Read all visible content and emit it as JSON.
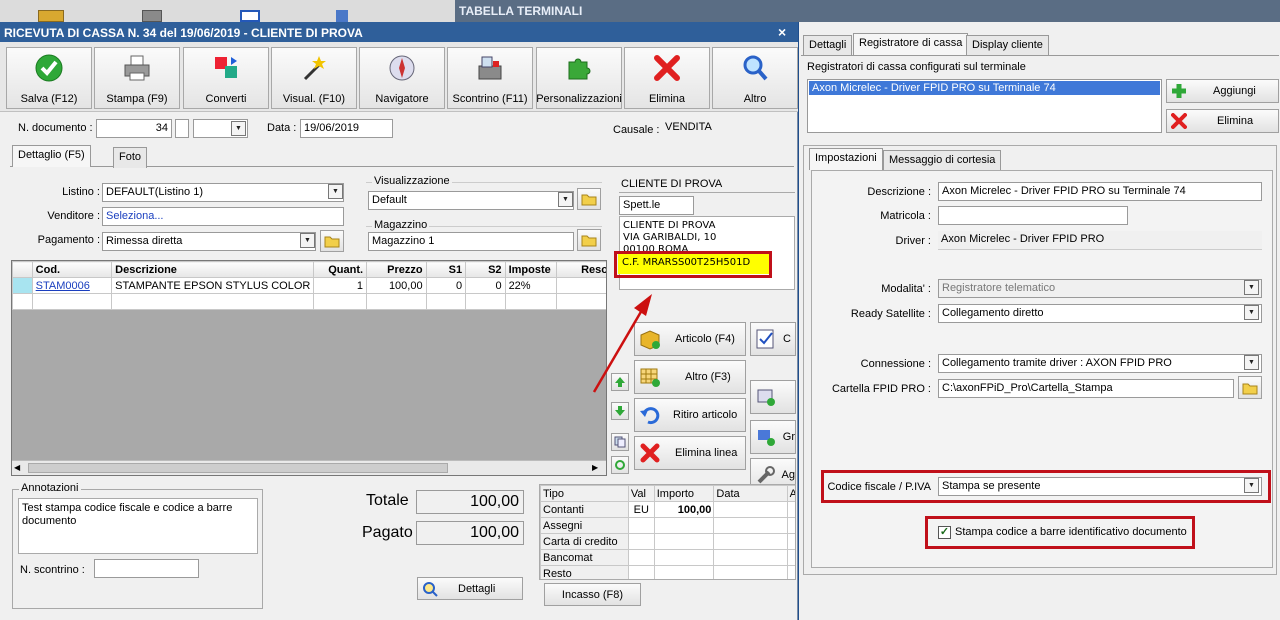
{
  "colors": {
    "desktop": "#1f4e8c",
    "titlebar": "#2f5f9a",
    "highlight_border": "#c0101a",
    "cf_background": "#ffff00",
    "link": "#1a3fbf",
    "selection": "#3f78d8",
    "arrow": "#cc1010"
  },
  "taskbar": {
    "title": "TABELLA TERMINALI"
  },
  "receipt": {
    "title": "RICEVUTA DI CASSA N. 34 del 19/06/2019 - CLIENTE DI PROVA",
    "close": "×",
    "toolbar": [
      {
        "label": "Salva (F12)",
        "icon": "check-icon"
      },
      {
        "label": "Stampa (F9)",
        "icon": "printer-icon"
      },
      {
        "label": "Converti",
        "icon": "convert-icon"
      },
      {
        "label": "Visual. (F10)",
        "icon": "magic-wand-icon"
      },
      {
        "label": "Navigatore",
        "icon": "compass-icon"
      },
      {
        "label": "Scontrino (F11)",
        "icon": "cash-register-icon"
      },
      {
        "label": "Personalizzazioni",
        "icon": "puzzle-icon"
      },
      {
        "label": "Elimina",
        "icon": "x-icon"
      },
      {
        "label": "Altro",
        "icon": "magnifier-icon"
      }
    ],
    "doc": {
      "num_label": "N. documento :",
      "num_value": "34",
      "date_label": "Data :",
      "date_value": "19/06/2019",
      "causale_label": "Causale :",
      "causale_value": "VENDITA"
    },
    "tabs": {
      "dettaglio": "Dettaglio (F5)",
      "foto": "Foto"
    },
    "listino": {
      "label": "Listino :",
      "value": "DEFAULT(Listino 1)"
    },
    "venditore": {
      "label": "Venditore :",
      "value": "Seleziona..."
    },
    "pagamento": {
      "label": "Pagamento :",
      "value": "Rimessa diretta"
    },
    "visualizzazione": {
      "label": "Visualizzazione",
      "value": "Default"
    },
    "magazzino": {
      "label": "Magazzino",
      "value": "Magazzino 1"
    },
    "customer": {
      "name": "CLIENTE DI PROVA",
      "salutation": "Spett.le",
      "address1": "CLIENTE DI PROVA",
      "address2": "VIA GARIBALDI, 10",
      "address3": "00100 ROMA",
      "cf": "C.F. MRARSS00T25H501D"
    },
    "grid": {
      "headers": [
        "Cod.",
        "Descrizione",
        "Quant.",
        "Prezzo",
        "S1",
        "S2",
        "Imposte",
        "Reso"
      ],
      "rows": [
        [
          "STAM0006",
          "STAMPANTE EPSON STYLUS COLOR",
          "1",
          "100,00",
          "0",
          "0",
          "22%",
          ""
        ]
      ]
    },
    "actions": {
      "articolo": "Articolo (F4)",
      "altro": "Altro (F3)",
      "ritiro": "Ritiro articolo",
      "elimina_linea": "Elimina linea",
      "c": "C",
      "gr": "Gr",
      "ag": "Ag"
    },
    "annotazioni": {
      "label": "Annotazioni",
      "text": "Test stampa codice fiscale e codice a barre documento",
      "scontrino_label": "N. scontrino :"
    },
    "totale": {
      "label": "Totale",
      "value": "100,00"
    },
    "pagato": {
      "label": "Pagato",
      "value": "100,00"
    },
    "dettagli": "Dettagli",
    "payments": {
      "headers": [
        "Tipo",
        "Val",
        "Importo",
        "Data",
        "A"
      ],
      "rows": [
        [
          "Contanti",
          "EU",
          "100,00",
          ""
        ],
        [
          "Assegni",
          "",
          "",
          ""
        ],
        [
          "Carta di credito",
          "",
          "",
          ""
        ],
        [
          "Bancomat",
          "",
          "",
          ""
        ],
        [
          "Resto",
          "",
          "",
          ""
        ]
      ]
    },
    "incasso": "Incasso (F8)"
  },
  "terminals": {
    "tabs": [
      "Dettagli",
      "Registratore di cassa",
      "Display cliente"
    ],
    "list_label": "Registratori di cassa configurati sul terminale",
    "list_items": [
      "Axon Micrelec - Driver FPID PRO su Terminale 74"
    ],
    "aggiungi": "Aggiungi",
    "elimina": "Elimina",
    "subtabs": [
      "Impostazioni",
      "Messaggio di cortesia"
    ],
    "descrizione": {
      "label": "Descrizione :",
      "value": "Axon Micrelec - Driver FPID PRO su Terminale 74"
    },
    "matricola": {
      "label": "Matricola :",
      "value": ""
    },
    "driver": {
      "label": "Driver :",
      "value": "Axon Micrelec - Driver FPID PRO"
    },
    "modalita": {
      "label": "Modalita' :",
      "value": "Registratore telematico"
    },
    "ready": {
      "label": "Ready Satellite :",
      "value": "Collegamento diretto"
    },
    "connessione": {
      "label": "Connessione :",
      "value": "Collegamento tramite driver : AXON FPID PRO"
    },
    "cartella": {
      "label": "Cartella FPID PRO :",
      "value": "C:\\axonFPiD_Pro\\Cartella_Stampa"
    },
    "codice_fiscale": {
      "label": "Codice fiscale / P.IVA",
      "value": "Stampa se presente"
    },
    "barcode": {
      "label": "Stampa codice a barre identificativo documento",
      "checked": true
    }
  }
}
